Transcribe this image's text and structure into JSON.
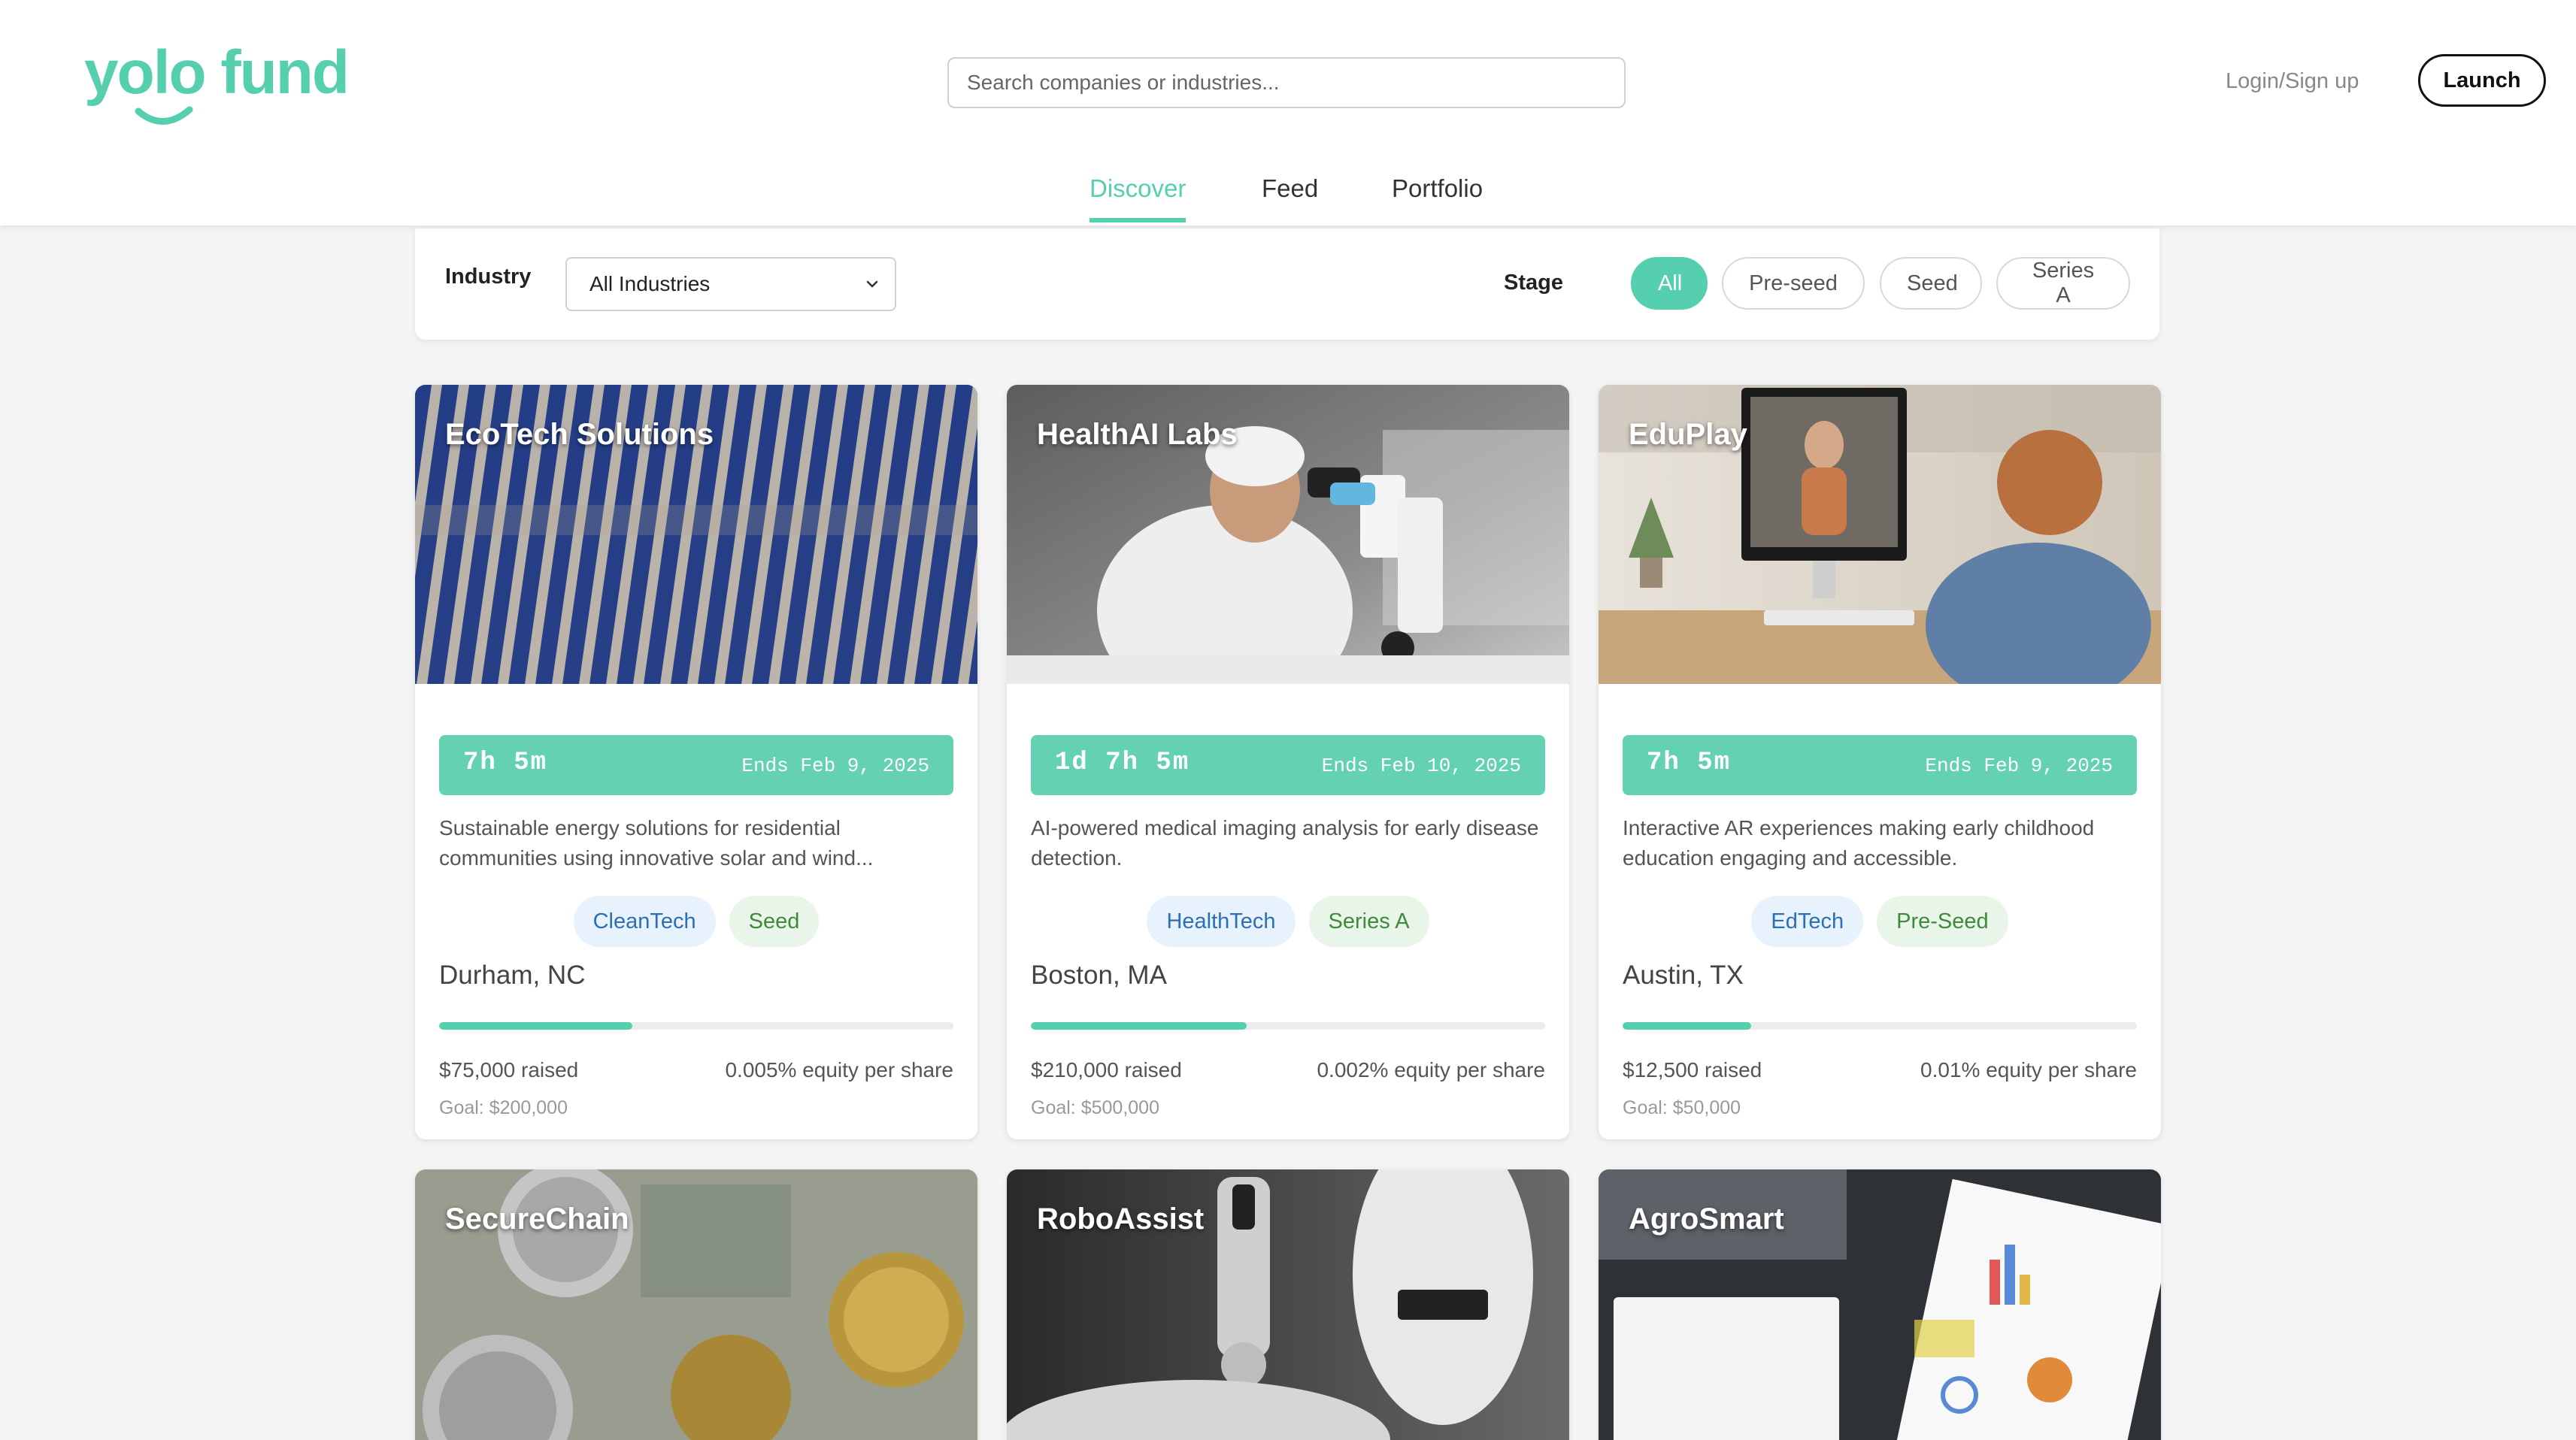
{
  "brand": {
    "logo_text": "yolo fund",
    "accent": "#56cfae"
  },
  "search": {
    "placeholder": "Search companies or industries..."
  },
  "header": {
    "login_label": "Login/Sign up",
    "launch_label": "Launch"
  },
  "tabs": [
    {
      "label": "Discover",
      "active": true
    },
    {
      "label": "Feed",
      "active": false
    },
    {
      "label": "Portfolio",
      "active": false
    }
  ],
  "filters": {
    "industry_label": "Industry",
    "industry_selected": "All Industries",
    "stage_label": "Stage",
    "stages": [
      {
        "label": "All",
        "active": true
      },
      {
        "label": "Pre-seed",
        "active": false
      },
      {
        "label": "Seed",
        "active": false
      },
      {
        "label": "Series A",
        "active": false
      }
    ]
  },
  "companies": [
    {
      "name": "EcoTech Solutions",
      "image": "solar-panels",
      "time_left": "7h 5m",
      "ends": "Ends Feb 9, 2025",
      "description": "Sustainable energy solutions for residential communities using innovative solar and wind...",
      "industry": "CleanTech",
      "stage": "Seed",
      "location": "Durham, NC",
      "progress": 0.375,
      "raised": "$75,000 raised",
      "equity": "0.005% equity per share",
      "goal": "Goal: $200,000"
    },
    {
      "name": "HealthAI Labs",
      "image": "lab-microscope",
      "time_left": "1d 7h 5m",
      "ends": "Ends Feb 10, 2025",
      "description": "AI-powered medical imaging analysis for early disease detection.",
      "industry": "HealthTech",
      "stage": "Series A",
      "location": "Boston, MA",
      "progress": 0.42,
      "raised": "$210,000 raised",
      "equity": "0.002% equity per share",
      "goal": "Goal: $500,000"
    },
    {
      "name": "EduPlay",
      "image": "child-video-call",
      "time_left": "7h 5m",
      "ends": "Ends Feb 9, 2025",
      "description": "Interactive AR experiences making early childhood education engaging and accessible.",
      "industry": "EdTech",
      "stage": "Pre-Seed",
      "location": "Austin, TX",
      "progress": 0.25,
      "raised": "$12,500 raised",
      "equity": "0.01% equity per share",
      "goal": "Goal: $50,000"
    },
    {
      "name": "SecureChain",
      "image": "crypto-coins"
    },
    {
      "name": "RoboAssist",
      "image": "robot-arm"
    },
    {
      "name": "AgroSmart",
      "image": "charts-desk"
    }
  ]
}
